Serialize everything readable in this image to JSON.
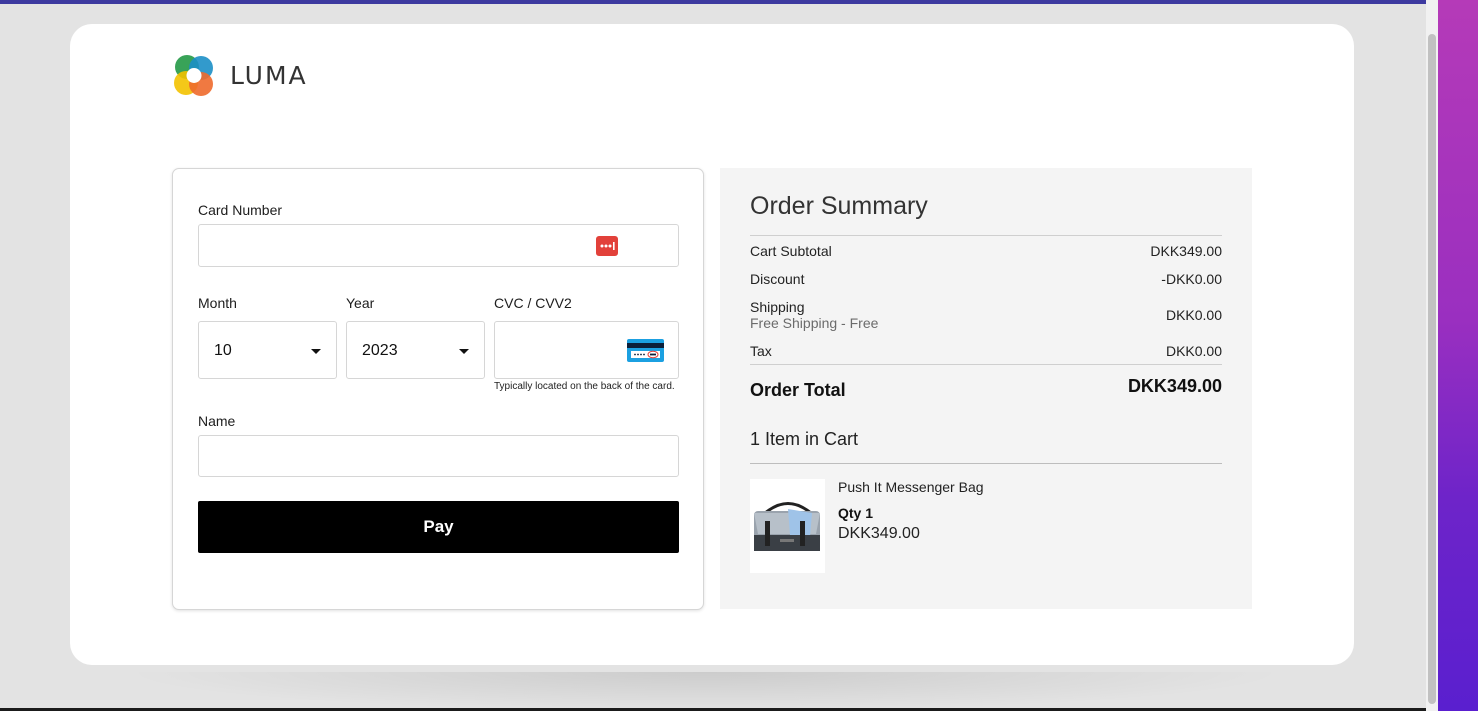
{
  "brand": {
    "name": "LUMA"
  },
  "payment_form": {
    "card_number": {
      "label": "Card Number",
      "value": "",
      "icon": "card-options-icon"
    },
    "month": {
      "label": "Month",
      "selected": "10"
    },
    "year": {
      "label": "Year",
      "selected": "2023"
    },
    "cvc": {
      "label": "CVC / CVV2",
      "value": "",
      "hint": "Typically located on the back of the card.",
      "icon": "card-back-cvc-icon"
    },
    "name": {
      "label": "Name",
      "value": ""
    },
    "pay_button": "Pay"
  },
  "order_summary": {
    "title": "Order Summary",
    "rows": [
      {
        "label": "Cart Subtotal",
        "value": "DKK349.00"
      },
      {
        "label": "Discount",
        "value": "-DKK0.00"
      },
      {
        "label": "Shipping",
        "sublabel": "Free Shipping - Free",
        "value": "DKK0.00"
      },
      {
        "label": "Tax",
        "value": "DKK0.00"
      }
    ],
    "total": {
      "label": "Order Total",
      "value": "DKK349.00"
    },
    "items_count": "1 Item in Cart",
    "items": [
      {
        "name": "Push It Messenger Bag",
        "qty": "Qty 1",
        "price": "DKK349.00",
        "image": "messenger-bag-image"
      }
    ]
  },
  "colors": {
    "pay_button": "#000000",
    "summary_bg": "#f4f4f4",
    "card_icon_red": "#e2413a",
    "cvc_icon_blue": "#1ba0e1"
  }
}
